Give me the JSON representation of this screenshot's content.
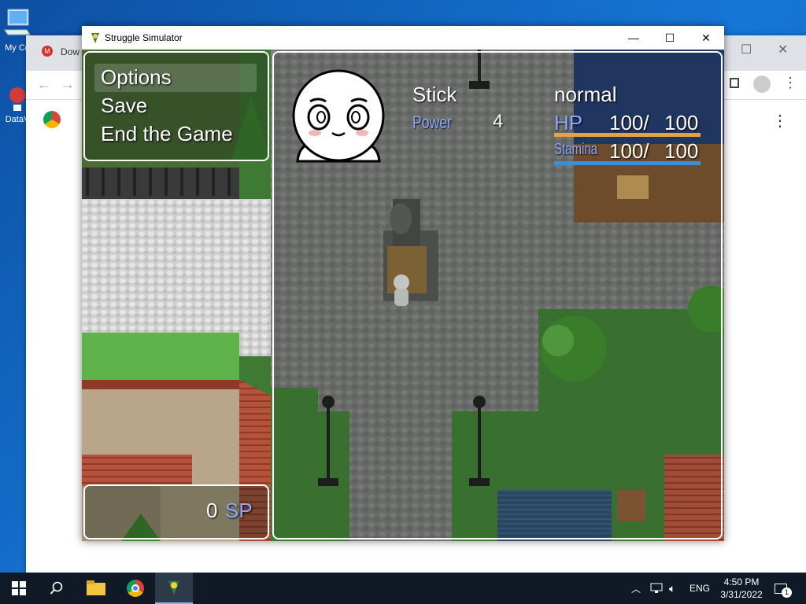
{
  "desktop": {
    "icons": [
      {
        "label": "My Co"
      },
      {
        "label": "DataV"
      }
    ]
  },
  "chrome": {
    "tab_label": "Dow"
  },
  "game_window": {
    "title": "Struggle Simulator"
  },
  "menu": {
    "items": [
      {
        "label": "Options"
      },
      {
        "label": "Save"
      },
      {
        "label": "End the Game"
      }
    ]
  },
  "sp": {
    "value": "0",
    "unit": "SP"
  },
  "status": {
    "name": "Stick",
    "state": "normal",
    "power_label": "Power",
    "power_value": "4",
    "hp_label": "HP",
    "hp_current": "100/",
    "hp_max": "100",
    "hp_fraction": 1.0,
    "stamina_label": "Stamina",
    "stamina_current": "100/",
    "stamina_max": "100",
    "stamina_fraction": 1.0
  },
  "colors": {
    "hp_bar": "#e8a040",
    "stamina_bar": "#3c8fd6",
    "label_blue": "#8fa8ff"
  },
  "taskbar": {
    "language": "ENG",
    "time": "4:50 PM",
    "date": "3/31/2022",
    "notifications": "1"
  }
}
